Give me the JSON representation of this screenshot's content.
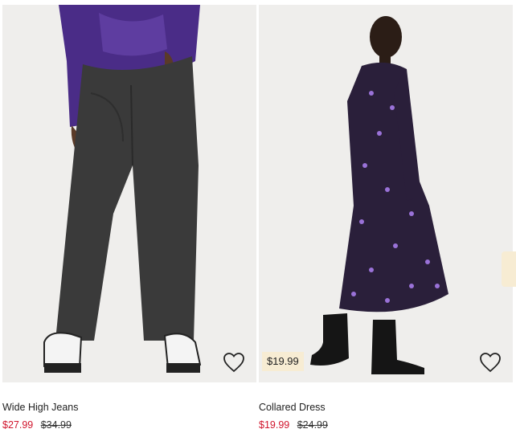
{
  "products": [
    {
      "title": "Wide High Jeans",
      "sale_price": "$27.99",
      "original_price": "$34.99"
    },
    {
      "title": "Collared Dress",
      "sale_price": "$19.99",
      "original_price": "$24.99",
      "badge": "$19.99"
    }
  ],
  "icons": {
    "favorite": "heart-outline-icon"
  },
  "colors": {
    "sale": "#d0142c",
    "badge_bg": "#f7ecd3",
    "photo_bg": "#efeeec"
  }
}
